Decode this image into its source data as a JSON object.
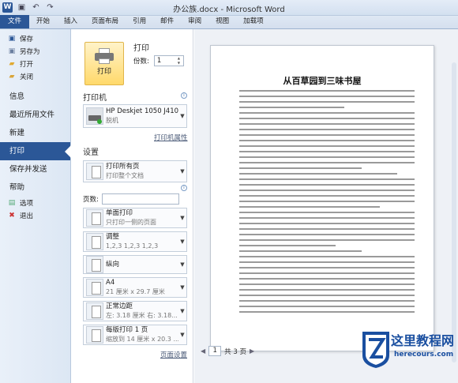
{
  "titlebar": {
    "title": "办公族.docx - Microsoft Word",
    "logo": "W"
  },
  "tabs": [
    "文件",
    "开始",
    "插入",
    "页面布局",
    "引用",
    "邮件",
    "审阅",
    "视图",
    "加载项"
  ],
  "nav": {
    "small": [
      {
        "label": "保存",
        "icon": "save-icon",
        "glyph": "▣",
        "color": "#2b5797"
      },
      {
        "label": "另存为",
        "icon": "save-as-icon",
        "glyph": "▣",
        "color": "#6b7fa0"
      },
      {
        "label": "打开",
        "icon": "open-folder-icon",
        "glyph": "▰",
        "color": "#e0a930"
      },
      {
        "label": "关闭",
        "icon": "close-doc-icon",
        "glyph": "▰",
        "color": "#d9a53a"
      }
    ],
    "big1": [
      "信息",
      "最近所用文件",
      "新建"
    ],
    "active": "打印",
    "big2": [
      "保存并发送",
      "帮助"
    ],
    "bottom": [
      {
        "label": "选项",
        "icon": "options-icon",
        "glyph": "▤",
        "color": "#5a7"
      },
      {
        "label": "退出",
        "icon": "exit-icon",
        "glyph": "✖",
        "color": "#c33"
      }
    ]
  },
  "print": {
    "heading": "打印",
    "button": "打印",
    "copies_label": "份数:",
    "copies_value": "1"
  },
  "printer": {
    "heading": "打印机",
    "name": "HP Deskjet 1050 J410 s...",
    "status": "脱机",
    "properties_link": "打印机属性"
  },
  "settings": {
    "heading": "设置",
    "pages_label": "页数:",
    "page_setup_link": "页面设置",
    "items": [
      {
        "main": "打印所有页",
        "sub": "打印整个文档"
      },
      {
        "main": "单面打印",
        "sub": "只打印一侧的页面"
      },
      {
        "main": "调整",
        "sub": "1,2,3    1,2,3    1,2,3"
      },
      {
        "main": "纵向",
        "sub": ""
      },
      {
        "main": "A4",
        "sub": "21 厘米 x 29.7 厘米"
      },
      {
        "main": "正常边距",
        "sub": "左: 3.18 厘米   右: 3.18..."
      },
      {
        "main": "每版打印 1 页",
        "sub": "缩放到 14 厘米 x 20.3 ..."
      }
    ]
  },
  "preview": {
    "doc_title": "从百草园到三味书屋",
    "page_current": "1",
    "page_total": "共 3 页"
  },
  "watermark": {
    "title": "这里教程网",
    "url": "herecours.com"
  }
}
